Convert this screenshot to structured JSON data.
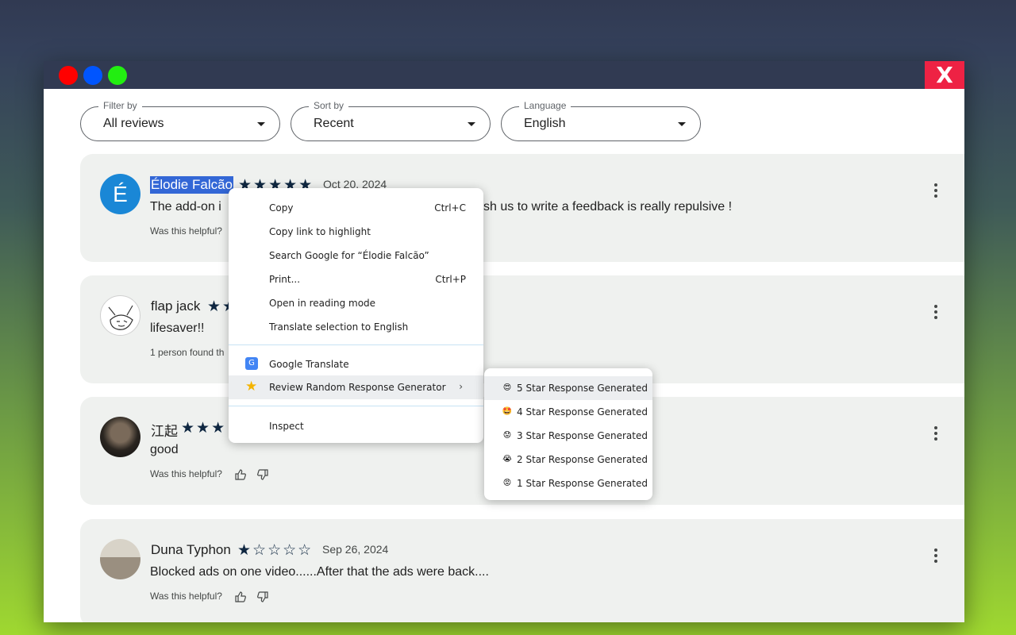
{
  "window": {
    "close_label": "X"
  },
  "filters": [
    {
      "label": "Filter by",
      "value": "All reviews"
    },
    {
      "label": "Sort by",
      "value": "Recent"
    },
    {
      "label": "Language",
      "value": "English"
    }
  ],
  "reviews": [
    {
      "avatar_letter": "É",
      "name": "Élodie Falcão",
      "stars": "★★★★★",
      "rating": 5,
      "date": "Oct 20, 2024",
      "text": "The add-on i",
      "text_tail": "sh us to write a feedback is really repulsive !",
      "helpful": "Was this helpful?"
    },
    {
      "name": "flap jack",
      "stars": "★★",
      "text": "lifesaver!!",
      "helpful": "1 person found th"
    },
    {
      "name": "江起",
      "stars": "★★★",
      "text": "good",
      "helpful": "Was this helpful?"
    },
    {
      "name": "Duna Typhon",
      "stars": "★☆☆☆☆",
      "rating": 1,
      "date": "Sep 26, 2024",
      "text": "Blocked ads on one video......After that the ads were back....",
      "helpful": "Was this helpful?"
    }
  ],
  "context_menu": {
    "items": [
      {
        "label": "Copy",
        "shortcut": "Ctrl+C"
      },
      {
        "label": "Copy link to highlight"
      },
      {
        "label": "Search Google for “Élodie Falcão”"
      },
      {
        "label": "Print...",
        "shortcut": "Ctrl+P"
      },
      {
        "label": "Open in reading mode"
      },
      {
        "label": "Translate selection to English"
      }
    ],
    "google_translate": "Google Translate",
    "google_translate_icon": "G",
    "extension": "Review Random Response Generator",
    "extension_arrow": "›",
    "inspect": "Inspect"
  },
  "submenu": {
    "items": [
      {
        "label": "5 Star Response Generated",
        "emoji": "😍"
      },
      {
        "label": "4 Star Response Generated",
        "emoji": "🤩"
      },
      {
        "label": "3 Star Response Generated",
        "emoji": "😟"
      },
      {
        "label": "2 Star Response Generated",
        "emoji": "😭"
      },
      {
        "label": "1 Star Response Generated",
        "emoji": "😡"
      }
    ]
  },
  "colors": {
    "accent": "#3367d6",
    "star": "#0f2741",
    "card_bg": "#eff1ef",
    "titlebar": "#313a52",
    "close": "#ee2244"
  }
}
